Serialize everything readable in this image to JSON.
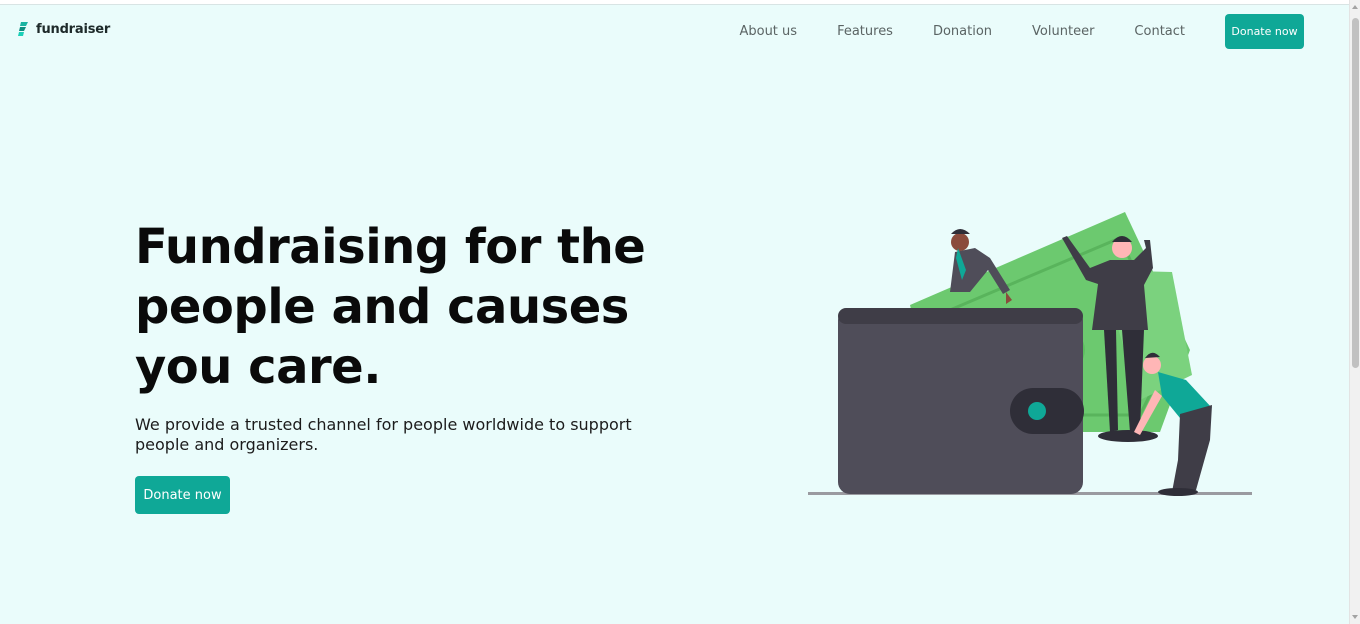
{
  "brand": {
    "name": "fundraiser",
    "accent": "#0fa897"
  },
  "nav": {
    "links": [
      "About us",
      "Features",
      "Donation",
      "Volunteer",
      "Contact"
    ],
    "cta_label": "Donate now"
  },
  "hero": {
    "title": "Fundraising for the people and causes you care.",
    "subtitle": "We provide a trusted channel for people worldwide to support people and organizers.",
    "cta_label": "Donate now"
  },
  "illustration": {
    "subject": "wallet-with-money-and-people",
    "colors": {
      "wallet": "#4f4d59",
      "money": "#6cc96f",
      "accent": "#0fa897"
    }
  }
}
